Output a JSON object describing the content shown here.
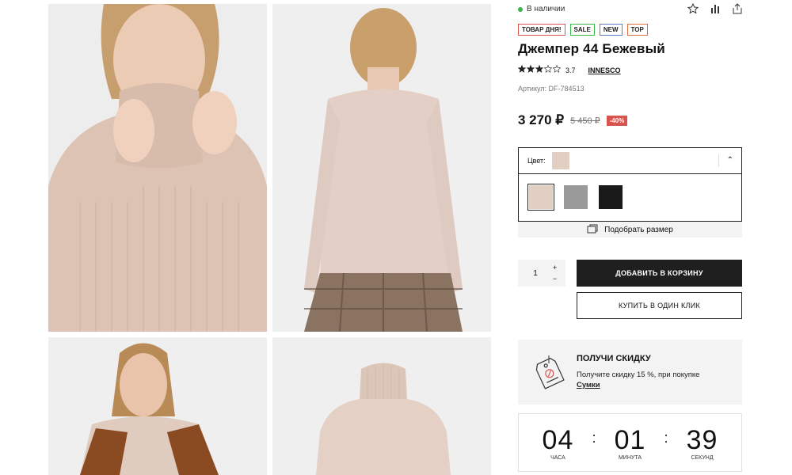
{
  "stock": {
    "label": "В наличии",
    "color": "#3bb54a"
  },
  "tags": [
    {
      "label": "ТОВАР ДНЯ!",
      "color": "#d9534f"
    },
    {
      "label": "SALE",
      "color": "#3bb54a"
    },
    {
      "label": "NEW",
      "color": "#5b7ec9"
    },
    {
      "label": "TOP",
      "color": "#e0683a"
    }
  ],
  "product": {
    "title": "Джемпер 44 Бежевый",
    "rating": "3.7",
    "rating_stars": 3.7,
    "brand": "INNESCO",
    "sku": "Артикул: DF-784513",
    "price": "3 270 ₽",
    "old_price": "5 450 ₽",
    "discount": "-40%"
  },
  "color_selector": {
    "label": "Цвет:",
    "options": [
      {
        "name": "beige",
        "color": "#e2cfc4"
      },
      {
        "name": "grey",
        "color": "#9a9a9a"
      },
      {
        "name": "black",
        "color": "#1a1a1a"
      }
    ]
  },
  "size_helper": {
    "label": "Подобрать размер"
  },
  "quantity": {
    "value": "1",
    "plus": "+",
    "minus": "−"
  },
  "buttons": {
    "add_to_cart": "ДОБАВИТЬ В КОРЗИНУ",
    "one_click": "КУПИТЬ В ОДИН КЛИК"
  },
  "promo": {
    "title": "ПОЛУЧИ СКИДКУ",
    "text": "Получите скидку 15 %, при покупке",
    "link": "Сумки"
  },
  "timer": {
    "hours": "04",
    "hours_label": "ЧАСА",
    "minutes": "01",
    "minutes_label": "МИНУТА",
    "seconds": "39",
    "seconds_label": "СЕКУНД",
    "separator": ":"
  },
  "icons": [
    "star-outline-icon",
    "compare-chart-icon",
    "share-icon",
    "ruler-icon",
    "discount-tag-icon"
  ]
}
